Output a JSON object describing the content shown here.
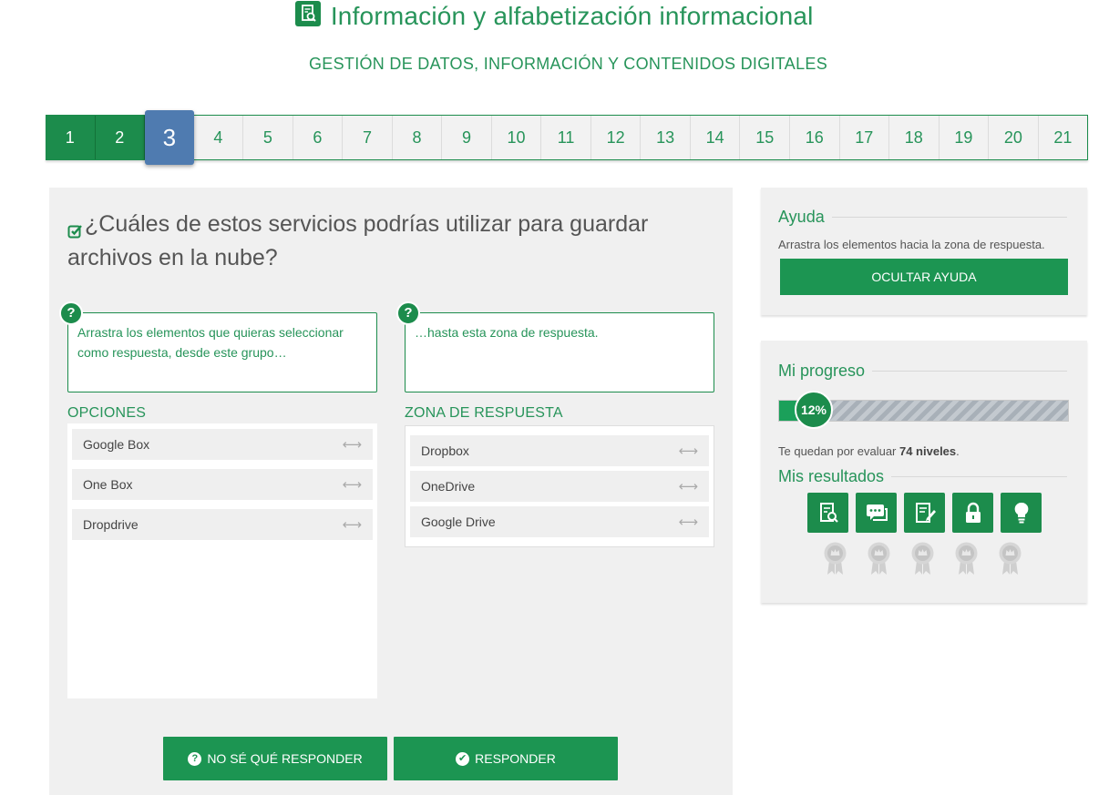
{
  "header": {
    "title": "Información y alfabetización informacional",
    "subtitle": "GESTIÓN DE DATOS, INFORMACIÓN Y CONTENIDOS DIGITALES",
    "icon": "document-search-icon"
  },
  "steps": {
    "items": [
      "1",
      "2",
      "3",
      "4",
      "5",
      "6",
      "7",
      "8",
      "9",
      "10",
      "11",
      "12",
      "13",
      "14",
      "15",
      "16",
      "17",
      "18",
      "19",
      "20",
      "21"
    ],
    "completed": 2,
    "current": "3"
  },
  "question": {
    "text": "¿Cuáles de estos servicios podrías utilizar para guardar archivos en la nube?",
    "hint_options": "Arrastra los elementos que quieras seleccionar como respuesta, desde este grupo…",
    "hint_answer": "…hasta esta zona de respuesta.",
    "options_heading": "OPCIONES",
    "answer_heading": "ZONA DE RESPUESTA",
    "options": [
      "Google Box",
      "One Box",
      "Dropdrive"
    ],
    "answers": [
      "Dropbox",
      "OneDrive",
      "Google Drive"
    ],
    "drag_glyph": "⟷",
    "hint_glyph": "?"
  },
  "buttons": {
    "unknown": "NO SÉ QUÉ RESPONDER",
    "answer": "RESPONDER"
  },
  "help": {
    "heading": "Ayuda",
    "text": "Arrastra los elementos hacia la zona de respuesta.",
    "hide_button": "OCULTAR AYUDA"
  },
  "progress": {
    "heading": "Mi progreso",
    "percent_value": 0.12,
    "percent_label": "12%",
    "remaining_prefix": "Te quedan por evaluar ",
    "remaining_count": "74 niveles",
    "remaining_suffix": ".",
    "results_heading": "Mis resultados",
    "result_icons": [
      "information-icon",
      "communication-icon",
      "content-creation-icon",
      "security-icon",
      "problem-solving-icon"
    ],
    "medal_icon": "medal-icon"
  },
  "colors": {
    "primary_green": "#1c8c4c",
    "button_green": "#1c9552",
    "current_step_blue": "#4f7bb0",
    "panel_gray": "#f0f0f0"
  }
}
